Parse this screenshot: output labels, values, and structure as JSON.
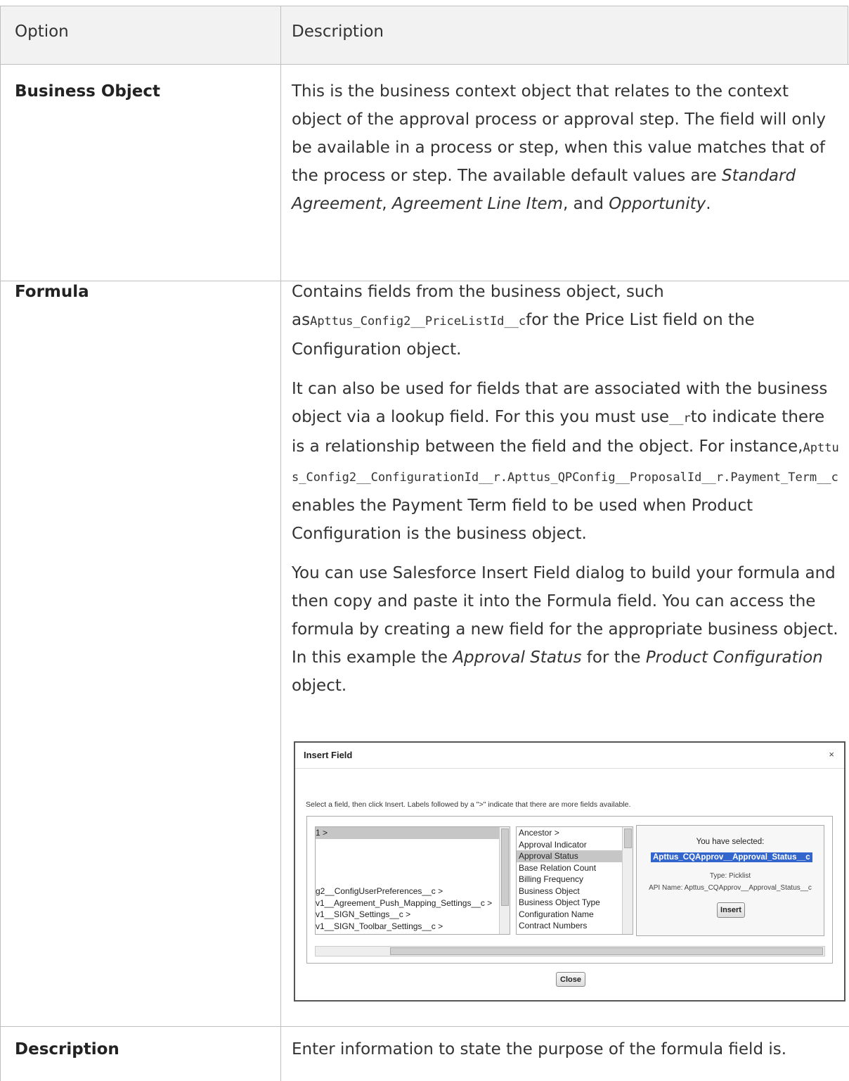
{
  "table": {
    "headers": {
      "option": "Option",
      "description": "Description"
    },
    "rows": {
      "business_object": {
        "option": "Business Object",
        "desc_pre": "This is the business context object that relates to the context object of the approval process or approval step. The field will only be available in a process or step, when this value matches that of the process or step. The available default values are ",
        "em1": "Standard Agreement",
        "sep1": ", ",
        "em2": "Agreement Line Item",
        "sep2": ", and ",
        "em3": "Opportunity",
        "end": "."
      },
      "formula": {
        "option": "Formula",
        "p1_pre": "Contains fields from the business object, such as",
        "p1_code": "Apttus_Config2__PriceListId__c",
        "p1_post": "for the Price List field on the Configuration object.",
        "p2_pre": "It can also be used for fields that are associated with the business object via a lookup field. For this you must use",
        "p2_code1": "__r",
        "p2_mid": "to indicate there is a relationship between the field and the object. For instance,",
        "p2_code2": "Apttus_Config2__ConfigurationId__r.Apttus_QPConfig__ProposalId__r.Payment_Term__c",
        "p2_post": "enables the Payment Term field to be used when Product Configuration is the business object.",
        "p3_pre": "You can use Salesforce Insert Field dialog to build your formula and then copy and paste it into the Formula field. You can access the formula by creating a new field for the appropriate business object. In this example the ",
        "p3_em1": "Approval Status",
        "p3_mid": " for the ",
        "p3_em2": "Product Configuration",
        "p3_post": " object."
      },
      "description": {
        "option": "Description",
        "desc": "Enter information to state the purpose of the formula field is."
      }
    }
  },
  "dialog": {
    "title": "Insert Field",
    "close_symbol": "×",
    "hint": "Select a field, then click Insert. Labels followed by a \">\" indicate that there are more fields available.",
    "list1": [
      "1 >",
      "",
      "",
      "",
      "",
      "g2__ConfigUserPreferences__c >",
      "v1__Agreement_Push_Mapping_Settings__c >",
      "v1__SIGN_Settings__c >",
      "v1__SIGN_Toolbar_Settings__c >"
    ],
    "list2": [
      "Ancestor >",
      "Approval Indicator",
      "Approval Status",
      "Base Relation Count",
      "Billing Frequency",
      "Business Object",
      "Business Object Type",
      "Configuration Name",
      "Contract Numbers"
    ],
    "selected_heading": "You have selected:",
    "selected_api": "Apttus_CQApprov__Approval_Status__c",
    "type_line": "Type: Picklist",
    "api_line": "API Name: Apttus_CQApprov__Approval_Status__c",
    "insert_label": "Insert",
    "close_label": "Close"
  }
}
